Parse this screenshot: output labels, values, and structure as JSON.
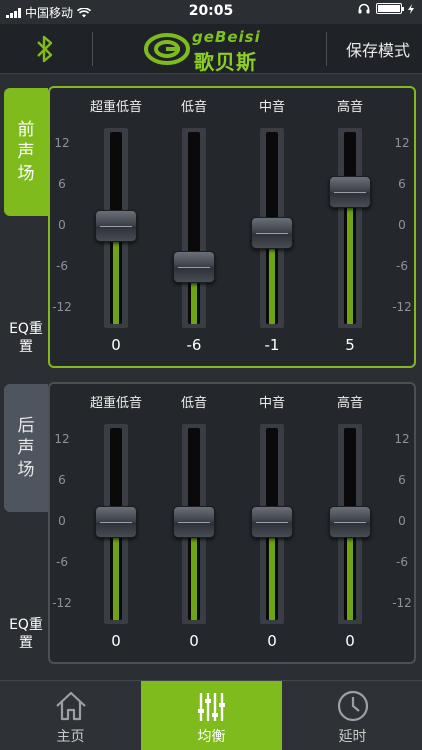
{
  "status_bar": {
    "carrier": "中国移动",
    "time": "20:05"
  },
  "header": {
    "bluetooth_icon": "bluetooth-icon",
    "brand_latin": "geBeisi",
    "brand_cn": "歌贝斯",
    "save_mode": "保存模式"
  },
  "scale_ticks": [
    "12",
    "6",
    "0",
    "-6",
    "-12"
  ],
  "band_labels": [
    "超重低音",
    "低音",
    "中音",
    "高音"
  ],
  "front": {
    "tab_label": "前声场",
    "eq_reset": "EQ重置",
    "values": [
      "0",
      "-6",
      "-1",
      "5"
    ],
    "levels": [
      0,
      -6,
      -1,
      5
    ]
  },
  "rear": {
    "tab_label": "后声场",
    "eq_reset": "EQ重置",
    "values": [
      "0",
      "0",
      "0",
      "0"
    ],
    "levels": [
      0,
      0,
      0,
      0
    ]
  },
  "nav": {
    "home": "主页",
    "balance": "均衡",
    "delay": "延时"
  },
  "colors": {
    "accent": "#7fbb1d",
    "background": "#2b2e33"
  }
}
